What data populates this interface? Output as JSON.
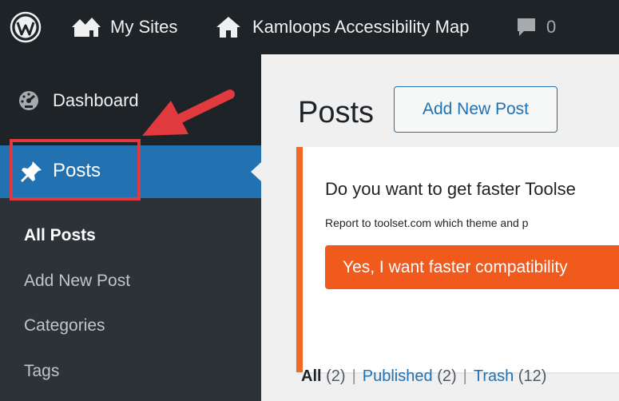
{
  "admin_bar": {
    "my_sites": "My Sites",
    "site_name": "Kamloops Accessibility Map",
    "comments_count": "0"
  },
  "sidebar": {
    "dashboard": "Dashboard",
    "posts": "Posts",
    "submenu": [
      "All Posts",
      "Add New Post",
      "Categories",
      "Tags"
    ]
  },
  "main": {
    "title": "Posts",
    "add_new": "Add New Post",
    "notice": {
      "heading": "Do you want to get faster Toolse",
      "description": "Report to toolset.com which theme and p",
      "button": "Yes, I want faster compatibility"
    },
    "filters": {
      "all_label": "All",
      "all_count": "(2)",
      "published_label": "Published",
      "published_count": "(2)",
      "trash_label": "Trash",
      "trash_count": "(12)",
      "separator": "|"
    }
  },
  "colors": {
    "admin_bg": "#1d2327",
    "submenu_bg": "#2c3338",
    "active_blue": "#2271b1",
    "notice_orange": "#f06a26",
    "annotation_red": "#e0393e"
  }
}
